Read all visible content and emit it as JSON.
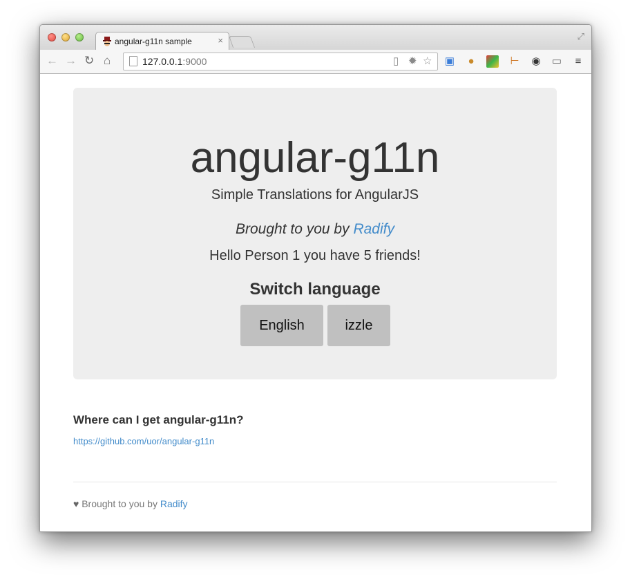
{
  "browser": {
    "tab_title": "angular-g11n sample",
    "tab_close": "×",
    "url_host": "127.0.0.1",
    "url_port": ":9000"
  },
  "page": {
    "title": "angular-g11n",
    "subtitle": "Simple Translations for AngularJS",
    "brought_prefix": "Brought to you by",
    "brought_link": "Radify",
    "greeting": "Hello Person 1 you have 5 friends!",
    "switch_heading": "Switch language",
    "language_buttons": [
      "English",
      "izzle"
    ],
    "where_heading": "Where can I get angular-g11n?",
    "repo_link": "https://github.com/uor/angular-g11n",
    "footer_prefix": "Brought to you by",
    "footer_link": "Radify"
  },
  "colors": {
    "link": "#428bca",
    "jumbotron_bg": "#eeeeee",
    "button_bg": "#c0c0c0",
    "text": "#333333"
  }
}
